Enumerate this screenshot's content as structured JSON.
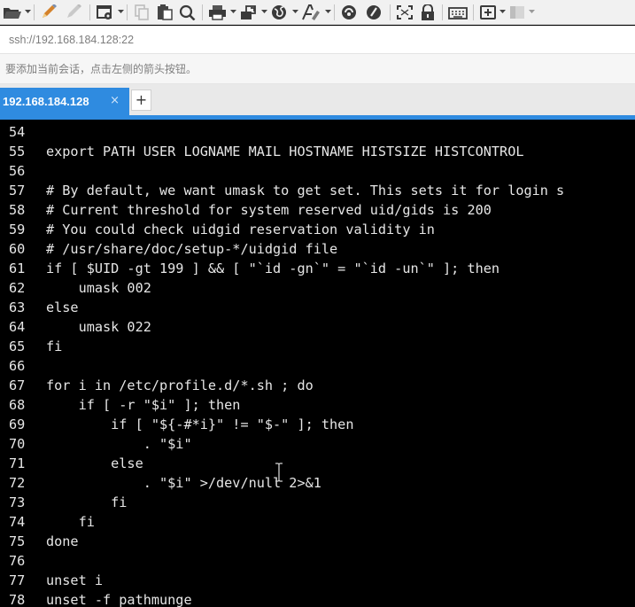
{
  "toolbar": {
    "buttons": [
      {
        "name": "folder-open-icon",
        "has_menu": true
      },
      {
        "name": "pencil-icon",
        "has_menu": false
      },
      {
        "name": "pencil-disabled-icon",
        "has_menu": false
      },
      {
        "name": "properties-icon",
        "has_menu": true
      },
      {
        "name": "copy-icon",
        "has_menu": false
      },
      {
        "name": "paste-icon",
        "has_menu": false
      },
      {
        "name": "find-icon",
        "has_menu": false
      },
      {
        "name": "print-icon",
        "has_menu": true
      },
      {
        "name": "transfer-icon",
        "has_menu": true
      },
      {
        "name": "globe-icon",
        "has_menu": true
      },
      {
        "name": "font-icon",
        "has_menu": true
      },
      {
        "name": "script-icon",
        "has_menu": false
      },
      {
        "name": "script-record-icon",
        "has_menu": false
      },
      {
        "name": "fullscreen-icon",
        "has_menu": false
      },
      {
        "name": "lock-icon",
        "has_menu": false
      },
      {
        "name": "keyboard-icon",
        "has_menu": false
      },
      {
        "name": "new-tab-icon",
        "has_menu": true
      },
      {
        "name": "layout-icon",
        "has_menu": true
      }
    ]
  },
  "address": {
    "value": "ssh://192.168.184.128:22"
  },
  "hint": {
    "text": "要添加当前会话，点击左侧的箭头按钮。"
  },
  "tabs": {
    "active_label": "192.168.184.128",
    "close_symbol": "×",
    "add_symbol": "+"
  },
  "colors": {
    "accent": "#2f8be0",
    "terminal_bg": "#000000",
    "terminal_fg": "#e6e6e6"
  },
  "terminal": {
    "lines": [
      {
        "n": "54",
        "text": ""
      },
      {
        "n": "55",
        "text": "export PATH USER LOGNAME MAIL HOSTNAME HISTSIZE HISTCONTROL"
      },
      {
        "n": "56",
        "text": ""
      },
      {
        "n": "57",
        "text": "# By default, we want umask to get set. This sets it for login s"
      },
      {
        "n": "58",
        "text": "# Current threshold for system reserved uid/gids is 200"
      },
      {
        "n": "59",
        "text": "# You could check uidgid reservation validity in"
      },
      {
        "n": "60",
        "text": "# /usr/share/doc/setup-*/uidgid file"
      },
      {
        "n": "61",
        "text": "if [ $UID -gt 199 ] && [ \"`id -gn`\" = \"`id -un`\" ]; then"
      },
      {
        "n": "62",
        "text": "    umask 002"
      },
      {
        "n": "63",
        "text": "else"
      },
      {
        "n": "64",
        "text": "    umask 022"
      },
      {
        "n": "65",
        "text": "fi"
      },
      {
        "n": "66",
        "text": ""
      },
      {
        "n": "67",
        "text": "for i in /etc/profile.d/*.sh ; do"
      },
      {
        "n": "68",
        "text": "    if [ -r \"$i\" ]; then"
      },
      {
        "n": "69",
        "text": "        if [ \"${-#*i}\" != \"$-\" ]; then"
      },
      {
        "n": "70",
        "text": "            . \"$i\""
      },
      {
        "n": "71",
        "text": "        else"
      },
      {
        "n": "72",
        "text": "            . \"$i\" >/dev/null 2>&1"
      },
      {
        "n": "73",
        "text": "        fi"
      },
      {
        "n": "74",
        "text": "    fi"
      },
      {
        "n": "75",
        "text": "done"
      },
      {
        "n": "76",
        "text": ""
      },
      {
        "n": "77",
        "text": "unset i"
      },
      {
        "n": "78",
        "text": "unset -f pathmunge"
      }
    ]
  }
}
